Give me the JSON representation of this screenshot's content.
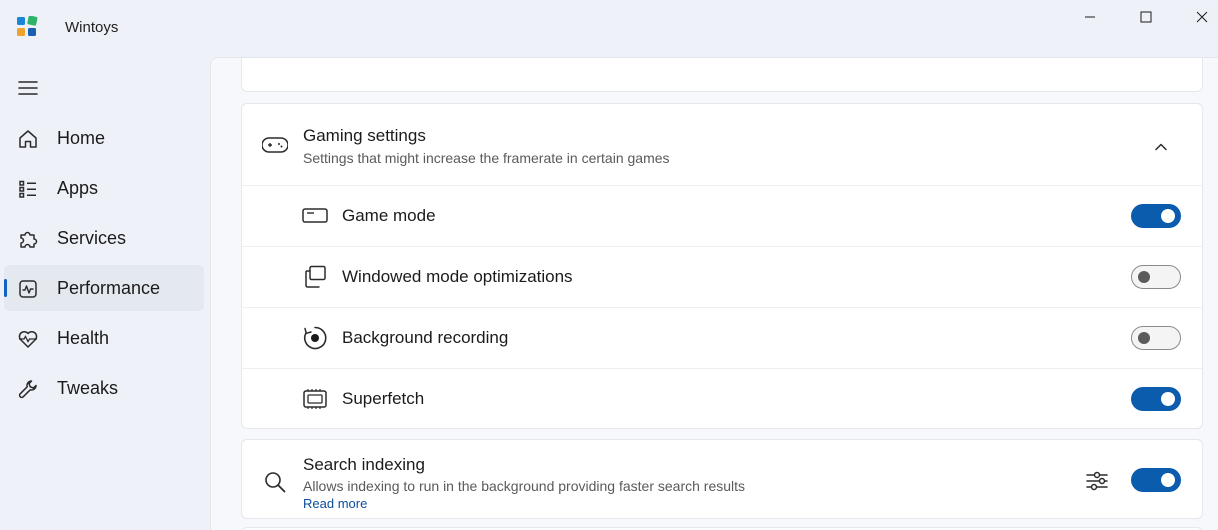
{
  "window": {
    "title": "Wintoys",
    "minimize_icon": "minimize-icon",
    "maximize_icon": "maximize-icon",
    "close_icon": "close-icon"
  },
  "nav": {
    "menu_icon": "hamburger-icon",
    "items": [
      {
        "label": "Home",
        "icon": "home-icon",
        "selected": false
      },
      {
        "label": "Apps",
        "icon": "apps-list-icon",
        "selected": false
      },
      {
        "label": "Services",
        "icon": "puzzle-icon",
        "selected": false
      },
      {
        "label": "Performance",
        "icon": "performance-icon",
        "selected": true
      },
      {
        "label": "Health",
        "icon": "heartbeat-icon",
        "selected": false
      },
      {
        "label": "Tweaks",
        "icon": "wrench-icon",
        "selected": false
      }
    ]
  },
  "gaming": {
    "title": "Gaming settings",
    "subtitle": "Settings that might increase the framerate in certain games",
    "icon": "gamepad-icon",
    "expanded": true,
    "rows": [
      {
        "label": "Game mode",
        "icon": "game-mode-icon",
        "enabled": true
      },
      {
        "label": "Windowed mode optimizations",
        "icon": "windows-stack-icon",
        "enabled": false
      },
      {
        "label": "Background recording",
        "icon": "record-icon",
        "enabled": false
      },
      {
        "label": "Superfetch",
        "icon": "chip-icon",
        "enabled": true
      }
    ]
  },
  "search_indexing": {
    "title": "Search indexing",
    "subtitle": "Allows indexing to run in the background providing faster search results",
    "link": "Read more",
    "icon": "search-icon",
    "settings_icon": "sliders-icon",
    "enabled": true
  },
  "colors": {
    "accent": "#0b5cad",
    "link": "#0b4d9a",
    "background": "#eef2f8",
    "card": "#ffffff"
  }
}
